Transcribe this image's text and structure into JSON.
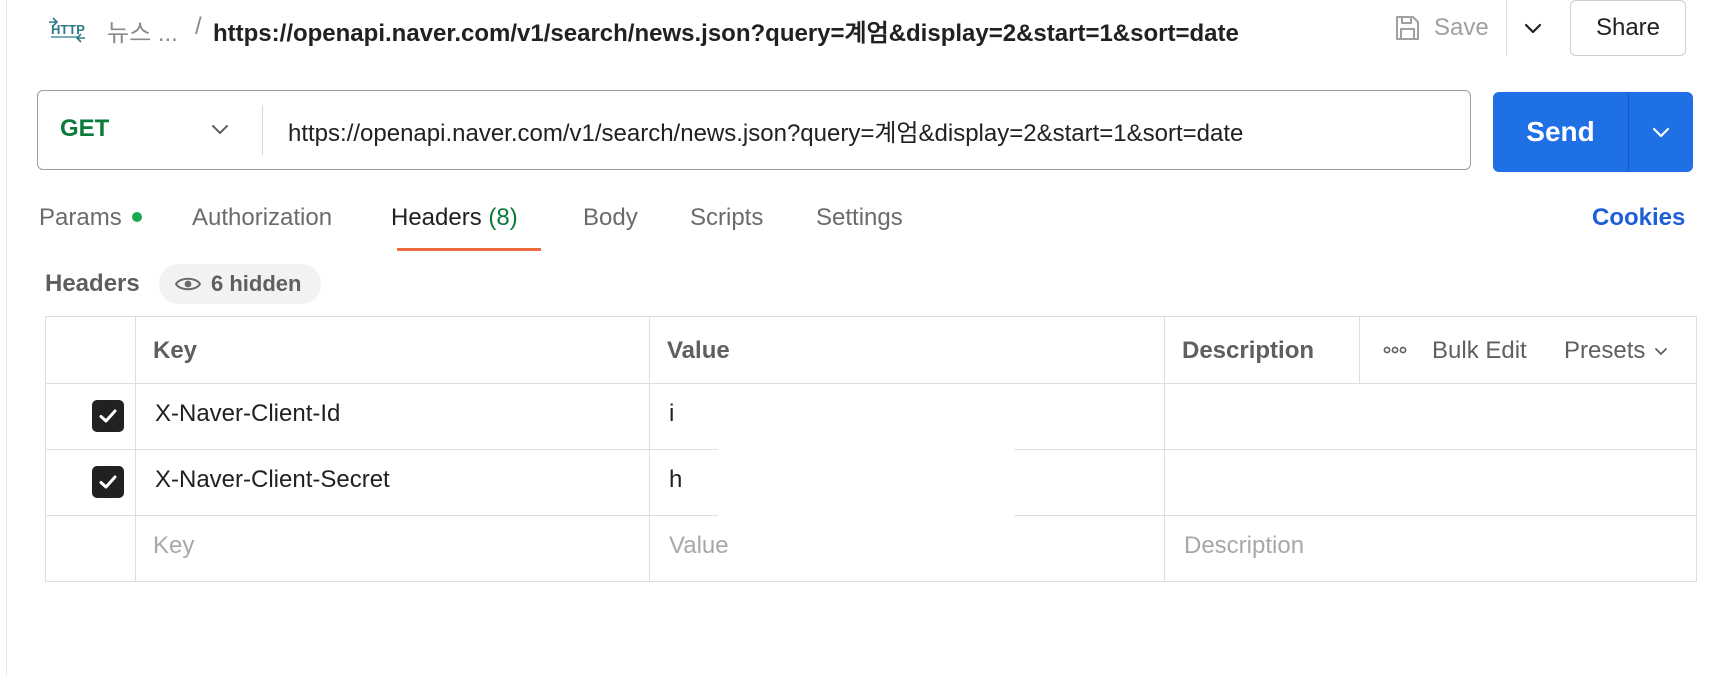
{
  "breadcrumb": {
    "parent": "뉴스 ...",
    "separator": "/",
    "title": "https://openapi.naver.com/v1/search/news.json?query=계엄&display=2&start=1&sort=date"
  },
  "toolbar": {
    "save_label": "Save",
    "share_label": "Share"
  },
  "request": {
    "method": "GET",
    "url": "https://openapi.naver.com/v1/search/news.json?query=계엄&display=2&start=1&sort=date",
    "send_label": "Send"
  },
  "tabs": [
    {
      "label": "Params",
      "has_indicator": true
    },
    {
      "label": "Authorization"
    },
    {
      "label": "Headers",
      "count": "(8)",
      "active": true
    },
    {
      "label": "Body"
    },
    {
      "label": "Scripts"
    },
    {
      "label": "Settings"
    }
  ],
  "cookies_label": "Cookies",
  "headers_section": {
    "title": "Headers",
    "hidden_label": "6 hidden"
  },
  "table": {
    "columns": {
      "key": "Key",
      "value": "Value",
      "description": "Description"
    },
    "bulk_edit_label": "Bulk Edit",
    "presets_label": "Presets",
    "rows": [
      {
        "checked": true,
        "key": "X-Naver-Client-Id",
        "value": "i",
        "description": ""
      },
      {
        "checked": true,
        "key": "X-Naver-Client-Secret",
        "value": "h",
        "description": ""
      }
    ],
    "placeholders": {
      "key": "Key",
      "value": "Value",
      "description": "Description"
    }
  },
  "colors": {
    "method_get": "#0b7b3a",
    "send_button": "#1f6fe5",
    "active_tab_underline": "#ef6c3e",
    "params_dot": "#1aa850",
    "cookies_link": "#1f5fd6"
  },
  "icons": [
    "http-icon",
    "save-icon",
    "chevron-down-icon",
    "eye-icon",
    "check-icon",
    "more-horizontal-icon"
  ]
}
